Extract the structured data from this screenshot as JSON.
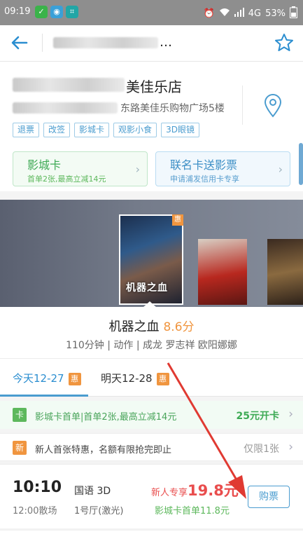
{
  "status_bar": {
    "time": "09:19",
    "network": "4G",
    "battery": "53%"
  },
  "header": {
    "title": "…"
  },
  "cinema": {
    "name": "美佳乐店",
    "address": "东路美佳乐购物广场5楼",
    "tags": [
      "退票",
      "改签",
      "影城卡",
      "观影小食",
      "3D眼镜"
    ]
  },
  "cards": [
    {
      "title": "影城卡",
      "subtitle": "首单2张,最高立减14元"
    },
    {
      "title": "联名卡送影票",
      "subtitle": "申请浦发信用卡专享"
    }
  ],
  "movie": {
    "poster_badge": "惠",
    "poster_title": "机器之血",
    "title": "机器之血",
    "score": "8.6分",
    "meta": "110分钟 | 动作 | 成龙 罗志祥 欧阳娜娜"
  },
  "date_tabs": [
    {
      "label": "今天12-27",
      "badge": "惠"
    },
    {
      "label": "明天12-28",
      "badge": "惠"
    }
  ],
  "promos": [
    {
      "badge": "卡",
      "text": "影城卡首单|首单2张,最高立减14元",
      "right": "25元开卡"
    },
    {
      "badge": "新",
      "text": "新人首张特惠，名额有限抢完即止",
      "right": "仅限1张"
    }
  ],
  "showtime": {
    "start": "10:10",
    "end": "12:00散场",
    "lang": "国语 3D",
    "hall": "1号厅(激光)",
    "price_prefix": "新人专享",
    "price": "19.8元",
    "card_price": "影城卡首单11.8元",
    "buy": "购票"
  },
  "colors": {
    "accent": "#4a9ccf",
    "orange": "#f0953f",
    "green": "#5db85c",
    "red": "#e94d4d",
    "arrow": "#e03a32"
  }
}
